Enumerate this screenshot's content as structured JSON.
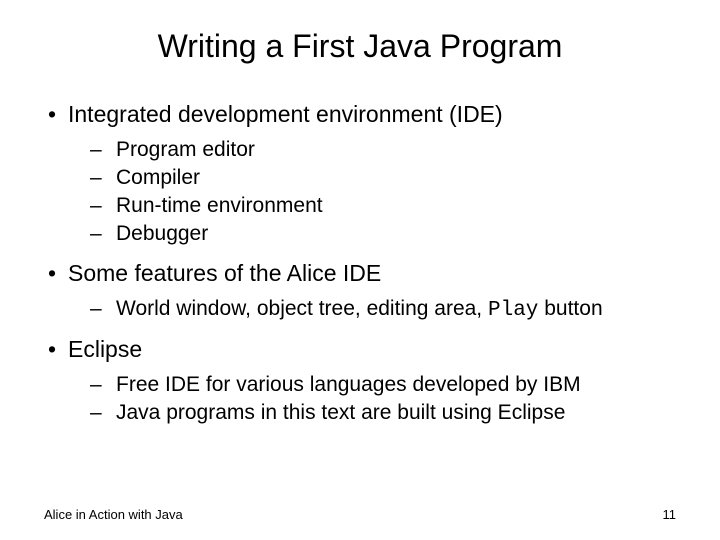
{
  "title": "Writing a First Java Program",
  "bullets": {
    "b1": "Integrated development environment (IDE)",
    "b1_sub": [
      "Program editor",
      "Compiler",
      "Run-time environment",
      "Debugger"
    ],
    "b2": "Some features of the Alice IDE",
    "b2_sub_prefix": "World window, object tree, editing area, ",
    "b2_sub_mono": "Play",
    "b2_sub_suffix": " button",
    "b3": "Eclipse",
    "b3_sub": [
      "Free IDE for various languages developed by IBM",
      "Java programs in this text are built using Eclipse"
    ]
  },
  "footer": {
    "left": "Alice in Action with Java",
    "right": "11"
  }
}
